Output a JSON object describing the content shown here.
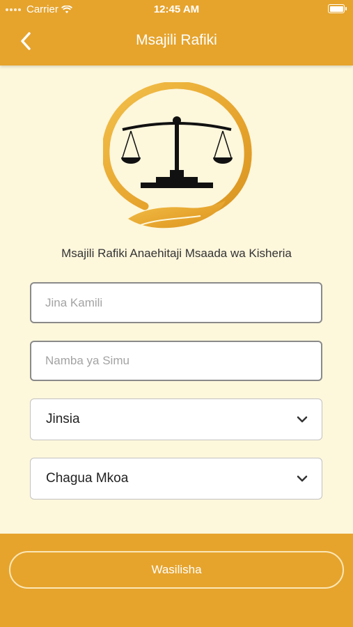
{
  "status_bar": {
    "carrier": "Carrier",
    "time": "12:45 AM",
    "battery_level": 1.0
  },
  "header": {
    "title": "Msajili Rafiki",
    "back_icon": "chevron-left-icon"
  },
  "logo": {
    "icon": "scales-of-justice-icon",
    "accent_color": "#e6a42d"
  },
  "form": {
    "subtitle": "Msajili Rafiki Anaehitaji Msaada wa Kisheria",
    "full_name": {
      "placeholder": "Jina Kamili",
      "value": ""
    },
    "phone": {
      "placeholder": "Namba ya Simu",
      "value": ""
    },
    "gender": {
      "selected": "Jinsia",
      "icon": "chevron-down-icon"
    },
    "region": {
      "selected": "Chagua Mkoa",
      "icon": "chevron-down-icon"
    }
  },
  "footer": {
    "submit_label": "Wasilisha"
  },
  "colors": {
    "brand": "#e6a42d",
    "background": "#fdf7dc"
  }
}
